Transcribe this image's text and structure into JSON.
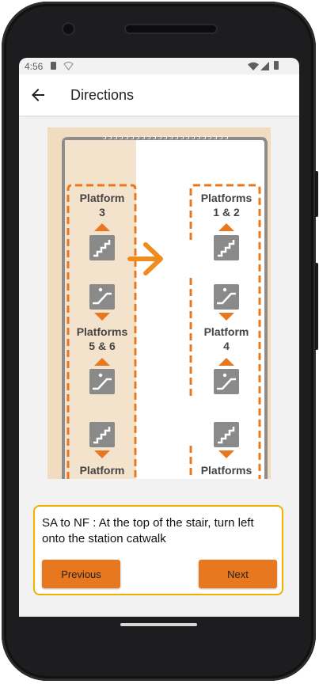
{
  "status": {
    "time": "4:56"
  },
  "appbar": {
    "title": "Directions"
  },
  "map": {
    "labels": {
      "platform_3": [
        "Platform",
        "3"
      ],
      "platforms_1_2": [
        "Platforms",
        "1 & 2"
      ],
      "platforms_5_6": [
        "Platforms",
        "5 & 6"
      ],
      "platform_4": [
        "Platform",
        "4"
      ],
      "platform_bottom_left": "Platform",
      "platforms_bottom_right": "Platforms"
    },
    "colors": {
      "accent": "#e8781f",
      "stair_icon": "#8a8a8a",
      "background": "#f2dcbf"
    }
  },
  "card": {
    "instruction": "SA to NF : At the top of the stair, turn left onto the station catwalk",
    "previous_label": "Previous",
    "next_label": "Next"
  }
}
